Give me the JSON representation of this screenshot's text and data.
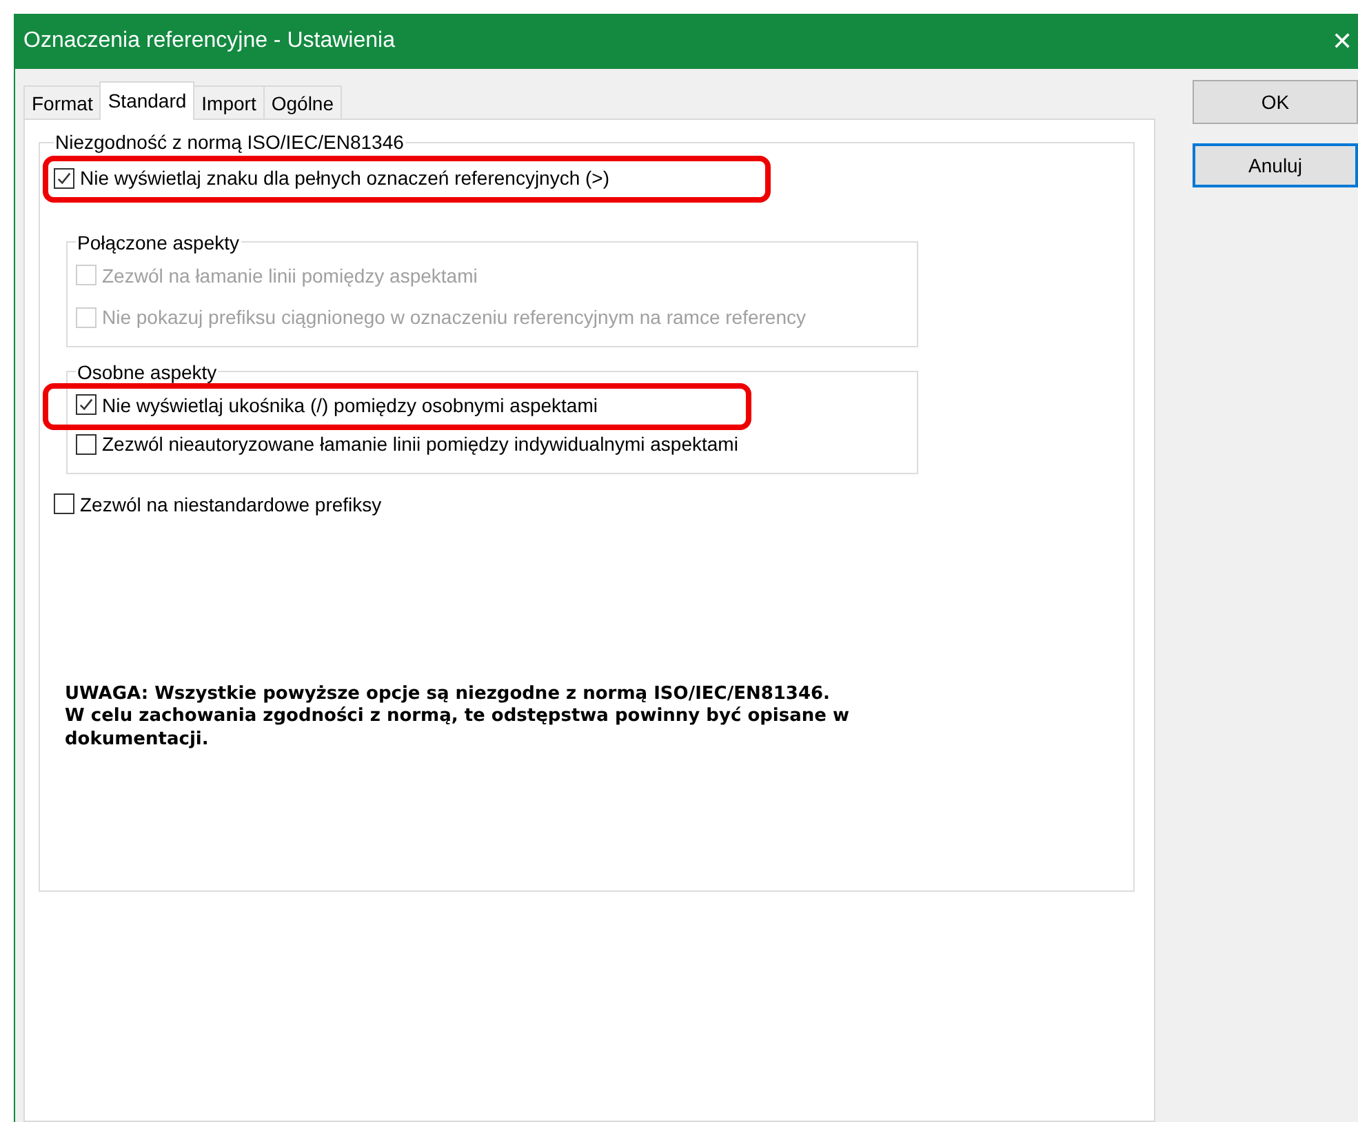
{
  "window": {
    "title": "Oznaczenia referencyjne - Ustawienia",
    "close": "✕"
  },
  "tabs": [
    {
      "label": "Format",
      "selected": false
    },
    {
      "label": "Standard",
      "selected": true
    },
    {
      "label": "Import",
      "selected": false
    },
    {
      "label": "Ogólne",
      "selected": false
    }
  ],
  "panel": {
    "title": "Niezgodność z normą ISO/IEC/EN81346",
    "items": [
      {
        "kind": "checkbox",
        "label": "Nie wyświetlaj znaku dla pełnych oznaczeń referencyjnych (>)",
        "checked": true,
        "disabled": false,
        "highlighted": true
      },
      {
        "kind": "group",
        "title": "Połączone aspekty",
        "items": [
          {
            "label": "Zezwól na łamanie linii pomiędzy aspektami",
            "checked": false,
            "disabled": true,
            "highlighted": false
          },
          {
            "label": "Nie pokazuj prefiksu ciągnionego w oznaczeniu referencyjnym na ramce referency",
            "checked": false,
            "disabled": true,
            "highlighted": false
          }
        ]
      },
      {
        "kind": "group",
        "title": "Osobne aspekty",
        "items": [
          {
            "label": "Nie wyświetlaj ukośnika (/) pomiędzy osobnymi aspektami",
            "checked": true,
            "disabled": false,
            "highlighted": true
          },
          {
            "label": "Zezwól nieautoryzowane łamanie linii pomiędzy indywidualnymi aspektami",
            "checked": false,
            "disabled": false,
            "highlighted": false
          }
        ]
      },
      {
        "kind": "checkbox",
        "label": "Zezwól na niestandardowe prefiksy",
        "checked": false,
        "disabled": false,
        "highlighted": false
      },
      {
        "kind": "note",
        "lines": [
          "UWAGA: Wszystkie powyższe opcje są niezgodne z normą ISO/IEC/EN81346.",
          "W celu zachowania zgodności z normą, te odstępstwa powinny być opisane w",
          "dokumentacji."
        ]
      }
    ]
  },
  "buttons": [
    {
      "label": "OK",
      "focused": false
    },
    {
      "label": "Anuluj",
      "focused": true
    }
  ]
}
